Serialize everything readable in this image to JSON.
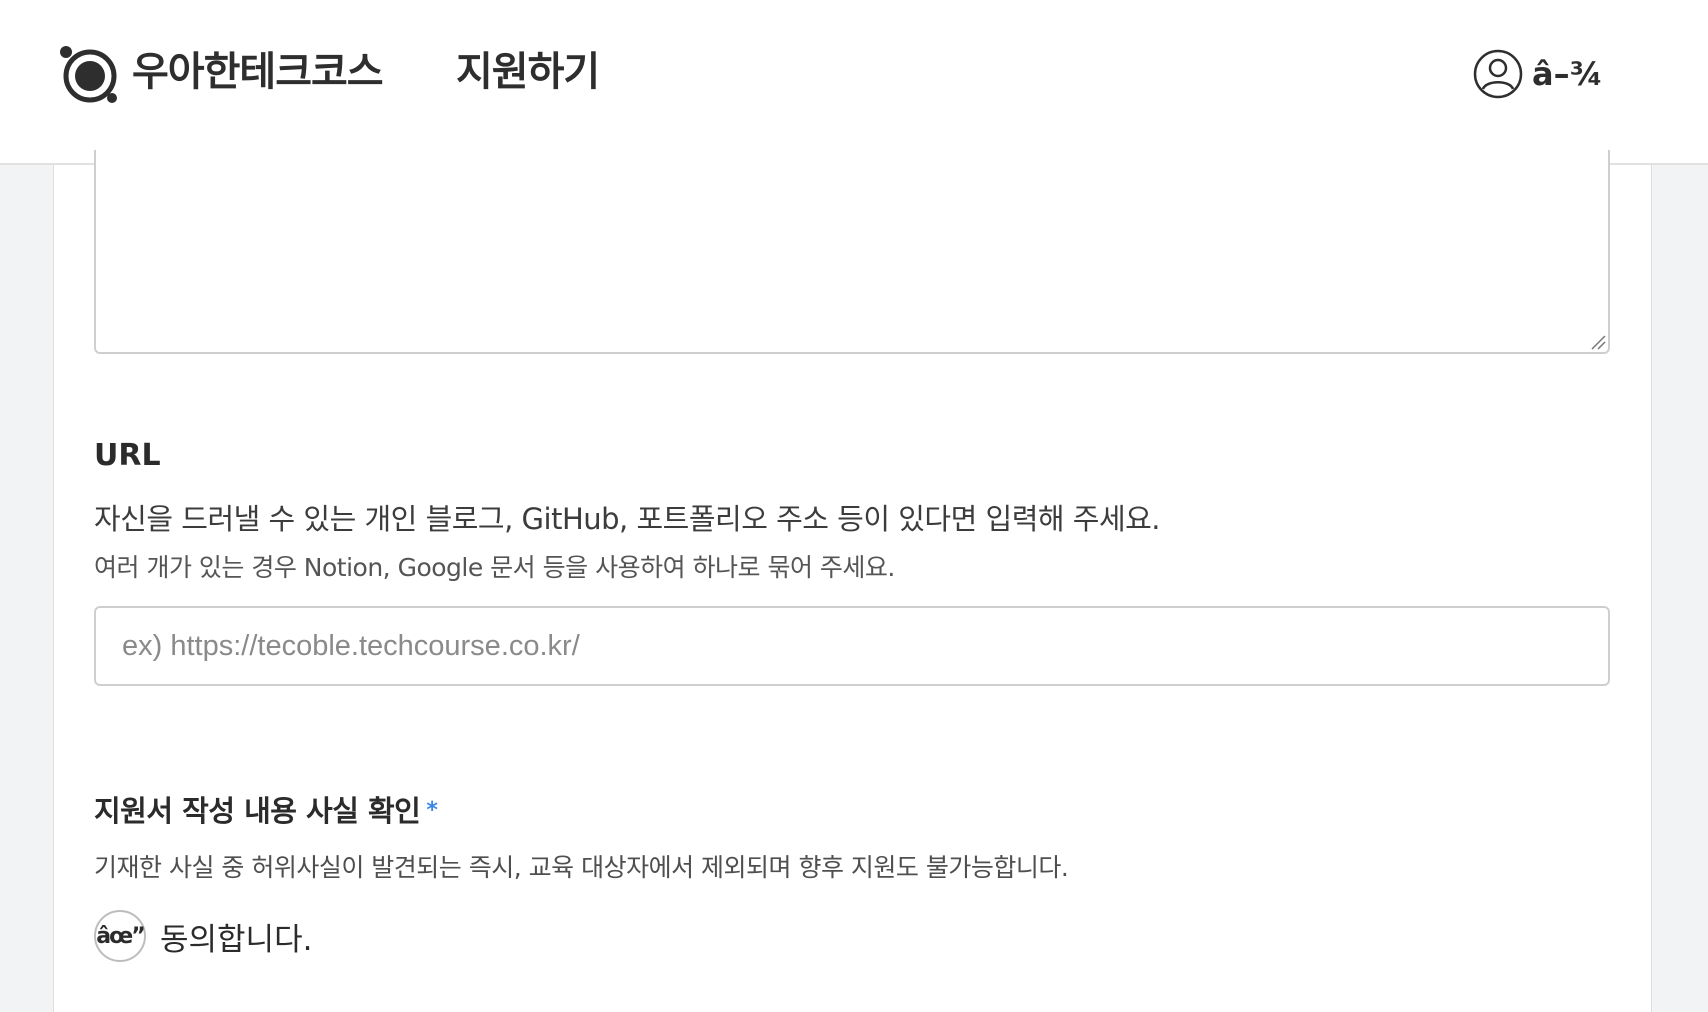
{
  "header": {
    "brand": "우아한테크코스",
    "subtitle": "지원하기",
    "user_label": "â–¾"
  },
  "url_section": {
    "title": "URL",
    "description": "자신을 드러낼 수 있는 개인 블로그, GitHub, 포트폴리오 주소 등이 있다면 입력해 주세요.",
    "hint": "여러 개가 있는 경우 Notion, Google 문서 등을 사용하여 하나로 묶어 주세요.",
    "placeholder": "ex) https://tecoble.techcourse.co.kr/",
    "value": ""
  },
  "confirm_section": {
    "title": "지원서 작성 내용 사실 확인",
    "required_mark": "*",
    "description": "기재한 사실 중 허위사실이 발견되는 즉시, 교육 대상자에서 제외되며 향후 지원도 불가능합니다.",
    "checkbox_glyph": "âœ”",
    "agree_label": "동의합니다."
  },
  "colors": {
    "accent": "#3b86e6",
    "background": "#f2f3f5",
    "border": "#cfcfcf"
  },
  "icons": {
    "logo": "techcourse-logo-icon",
    "user": "user-circle-icon",
    "resize": "resize-handle-icon"
  }
}
